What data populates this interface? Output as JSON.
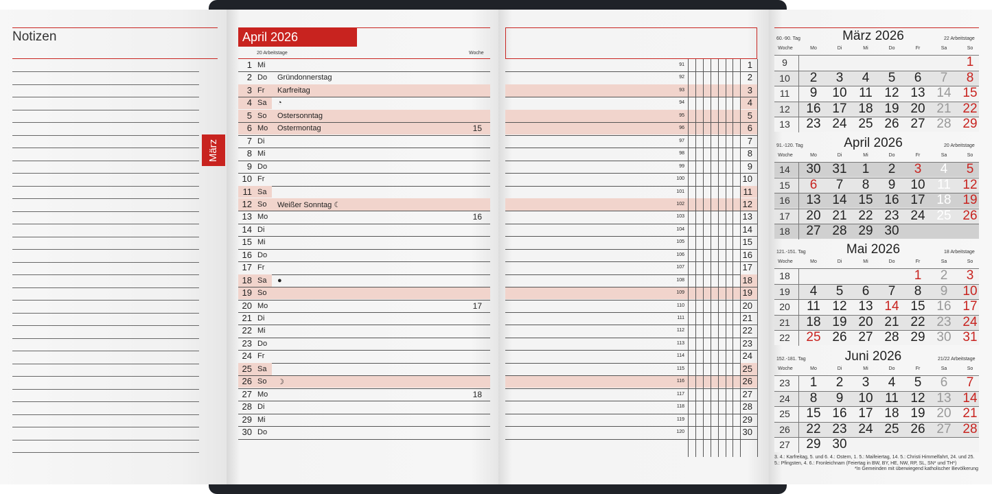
{
  "notes": {
    "title": "Notizen",
    "tab_label": "März"
  },
  "april": {
    "title": "April 2026",
    "workdays": "20 Arbeitstage",
    "week_label": "Woche",
    "days": [
      {
        "d": "1",
        "n": "Mi",
        "h": "",
        "w": "",
        "y": "91",
        "hl": false
      },
      {
        "d": "2",
        "n": "Do",
        "h": "Gründonnerstag",
        "w": "",
        "y": "92",
        "hl": false
      },
      {
        "d": "3",
        "n": "Fr",
        "h": "Karfreitag",
        "w": "",
        "y": "93",
        "hl": true
      },
      {
        "d": "4",
        "n": "Sa",
        "h": "◔",
        "w": "",
        "y": "94",
        "hl": true,
        "sat": true
      },
      {
        "d": "5",
        "n": "So",
        "h": "Ostersonntag",
        "w": "",
        "y": "95",
        "hl": true
      },
      {
        "d": "6",
        "n": "Mo",
        "h": "Ostermontag",
        "w": "15",
        "y": "96",
        "hl": true
      },
      {
        "d": "7",
        "n": "Di",
        "h": "",
        "w": "",
        "y": "97",
        "hl": false
      },
      {
        "d": "8",
        "n": "Mi",
        "h": "",
        "w": "",
        "y": "98",
        "hl": false
      },
      {
        "d": "9",
        "n": "Do",
        "h": "",
        "w": "",
        "y": "99",
        "hl": false
      },
      {
        "d": "10",
        "n": "Fr",
        "h": "",
        "w": "",
        "y": "100",
        "hl": false
      },
      {
        "d": "11",
        "n": "Sa",
        "h": "",
        "w": "",
        "y": "101",
        "hl": true,
        "sat": true
      },
      {
        "d": "12",
        "n": "So",
        "h": "Weißer Sonntag  ☾",
        "w": "",
        "y": "102",
        "hl": true
      },
      {
        "d": "13",
        "n": "Mo",
        "h": "",
        "w": "16",
        "y": "103",
        "hl": false
      },
      {
        "d": "14",
        "n": "Di",
        "h": "",
        "w": "",
        "y": "104",
        "hl": false
      },
      {
        "d": "15",
        "n": "Mi",
        "h": "",
        "w": "",
        "y": "105",
        "hl": false
      },
      {
        "d": "16",
        "n": "Do",
        "h": "",
        "w": "",
        "y": "106",
        "hl": false
      },
      {
        "d": "17",
        "n": "Fr",
        "h": "",
        "w": "",
        "y": "107",
        "hl": false
      },
      {
        "d": "18",
        "n": "Sa",
        "h": "●",
        "w": "",
        "y": "108",
        "hl": true,
        "sat": true
      },
      {
        "d": "19",
        "n": "So",
        "h": "",
        "w": "",
        "y": "109",
        "hl": true
      },
      {
        "d": "20",
        "n": "Mo",
        "h": "",
        "w": "17",
        "y": "110",
        "hl": false
      },
      {
        "d": "21",
        "n": "Di",
        "h": "",
        "w": "",
        "y": "111",
        "hl": false
      },
      {
        "d": "22",
        "n": "Mi",
        "h": "",
        "w": "",
        "y": "112",
        "hl": false
      },
      {
        "d": "23",
        "n": "Do",
        "h": "",
        "w": "",
        "y": "113",
        "hl": false
      },
      {
        "d": "24",
        "n": "Fr",
        "h": "",
        "w": "",
        "y": "114",
        "hl": false
      },
      {
        "d": "25",
        "n": "Sa",
        "h": "",
        "w": "",
        "y": "115",
        "hl": true,
        "sat": true
      },
      {
        "d": "26",
        "n": "So",
        "h": "☽",
        "w": "",
        "y": "116",
        "hl": true
      },
      {
        "d": "27",
        "n": "Mo",
        "h": "",
        "w": "18",
        "y": "117",
        "hl": false
      },
      {
        "d": "28",
        "n": "Di",
        "h": "",
        "w": "",
        "y": "118",
        "hl": false
      },
      {
        "d": "29",
        "n": "Mi",
        "h": "",
        "w": "",
        "y": "119",
        "hl": false
      },
      {
        "d": "30",
        "n": "Do",
        "h": "",
        "w": "",
        "y": "120",
        "hl": false
      }
    ]
  },
  "mini_cals": [
    {
      "title": "März 2026",
      "range": "60.-90. Tag",
      "workdays": "22 Arbeitstage",
      "rows": [
        [
          "9",
          "",
          "",
          "",
          "",
          "",
          "",
          "1"
        ],
        [
          "10",
          "2",
          "3",
          "4",
          "5",
          "6",
          "7",
          "8"
        ],
        [
          "11",
          "9",
          "10",
          "11",
          "12",
          "13",
          "14",
          "15"
        ],
        [
          "12",
          "16",
          "17",
          "18",
          "19",
          "20",
          "21",
          "22"
        ],
        [
          "13",
          "23",
          "24",
          "25",
          "26",
          "27",
          "28",
          "29"
        ]
      ]
    },
    {
      "title": "April 2026",
      "range": "91.-120. Tag",
      "workdays": "20 Arbeitstage",
      "rows": [
        [
          "14",
          "30",
          "31",
          "1",
          "2",
          "3",
          "4",
          "5"
        ],
        [
          "15",
          "6",
          "7",
          "8",
          "9",
          "10",
          "11",
          "12"
        ],
        [
          "16",
          "13",
          "14",
          "15",
          "16",
          "17",
          "18",
          "19"
        ],
        [
          "17",
          "20",
          "21",
          "22",
          "23",
          "24",
          "25",
          "26"
        ],
        [
          "18",
          "27",
          "28",
          "29",
          "30",
          "",
          "",
          ""
        ]
      ]
    },
    {
      "title": "Mai 2026",
      "range": "121.-151. Tag",
      "workdays": "18 Arbeitstage",
      "rows": [
        [
          "18",
          "",
          "",
          "",
          "",
          "1",
          "2",
          "3"
        ],
        [
          "19",
          "4",
          "5",
          "6",
          "7",
          "8",
          "9",
          "10"
        ],
        [
          "20",
          "11",
          "12",
          "13",
          "14",
          "15",
          "16",
          "17"
        ],
        [
          "21",
          "18",
          "19",
          "20",
          "21",
          "22",
          "23",
          "24"
        ],
        [
          "22",
          "25",
          "26",
          "27",
          "28",
          "29",
          "30",
          "31"
        ]
      ]
    },
    {
      "title": "Juni 2026",
      "range": "152.-181. Tag",
      "workdays": "21/22 Arbeitstage",
      "rows": [
        [
          "23",
          "1",
          "2",
          "3",
          "4",
          "5",
          "6",
          "7"
        ],
        [
          "24",
          "8",
          "9",
          "10",
          "11",
          "12",
          "13",
          "14"
        ],
        [
          "25",
          "15",
          "16",
          "17",
          "18",
          "19",
          "20",
          "21"
        ],
        [
          "26",
          "22",
          "23",
          "24",
          "25",
          "26",
          "27",
          "28"
        ],
        [
          "27",
          "29",
          "30",
          "",
          "",
          "",
          "",
          ""
        ]
      ]
    }
  ],
  "weekday_headers": [
    "Woche",
    "Mo",
    "Di",
    "Mi",
    "Do",
    "Fr",
    "Sa",
    "So"
  ],
  "footnote": "3. 4.: Karfreitag, 5. und 6. 4.: Ostern, 1. 5.: Maifeiertag, 14. 5.: Christi Himmelfahrt, 24. und 25. 5.: Pfingsten, 4. 6.: Fronleichnam (Feiertag in BW, BY, HE, NW, RP, SL, SN* und TH*)",
  "footnote2": "*In Gemeinden mit überwiegend katholischer Bevölkerung",
  "colors": {
    "accent": "#c8231f",
    "highlight": "#f1d4cc",
    "cover": "#1f2228"
  }
}
